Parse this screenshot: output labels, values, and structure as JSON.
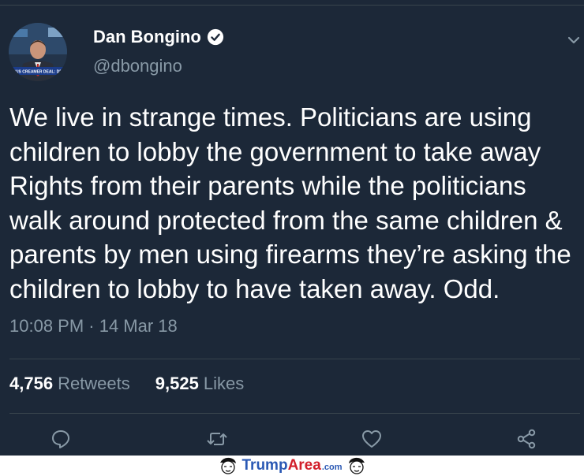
{
  "author": {
    "display_name": "Dan Bongino",
    "handle": "@dbongino",
    "verified": true,
    "avatar_caption": "TRUS CREAMER DEAL: DEM"
  },
  "tweet": {
    "text": "We live in strange times. Politicians are using children to lobby the government to take away Rights from their parents while the politicians walk around protected from the same children & parents by men using firearms they’re asking the children to lobby to have taken away. Odd.",
    "timestamp": "10:08 PM · 14 Mar 18"
  },
  "stats": {
    "retweets_count": "4,756",
    "retweets_label": "Retweets",
    "likes_count": "9,525",
    "likes_label": "Likes"
  },
  "actions": {
    "reply_icon": "reply-icon",
    "retweet_icon": "retweet-icon",
    "like_icon": "heart-icon",
    "share_icon": "share-icon"
  },
  "watermark": {
    "brand_trump": "Trump",
    "brand_area": "Area",
    "brand_com": ".com"
  },
  "colors": {
    "background": "#1c2838",
    "secondary_text": "#8899a6",
    "divider": "#38444d"
  }
}
